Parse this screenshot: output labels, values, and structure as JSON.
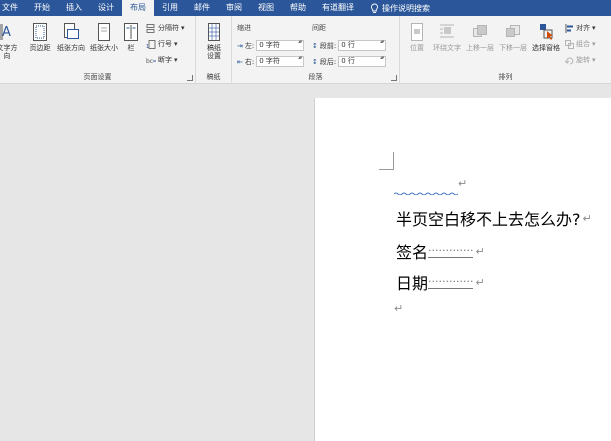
{
  "tabs": [
    {
      "label": "文件",
      "active": false
    },
    {
      "label": "开始",
      "active": false
    },
    {
      "label": "插入",
      "active": false
    },
    {
      "label": "设计",
      "active": false
    },
    {
      "label": "布局",
      "active": true
    },
    {
      "label": "引用",
      "active": false
    },
    {
      "label": "邮件",
      "active": false
    },
    {
      "label": "审阅",
      "active": false
    },
    {
      "label": "视图",
      "active": false
    },
    {
      "label": "帮助",
      "active": false
    },
    {
      "label": "有道翻译",
      "active": false
    }
  ],
  "tell_me": "操作说明搜索",
  "ribbon": {
    "page_setup": {
      "label": "页面设置",
      "text_direction": "文字方向",
      "margins": "页边距",
      "orientation": "纸张方向",
      "size": "纸张大小",
      "columns": "栏",
      "breaks": "分隔符",
      "line_numbers": "行号",
      "hyphenation": "断字"
    },
    "manuscript": {
      "label": "稿纸",
      "button": "稿纸设置"
    },
    "paragraph": {
      "label": "段落",
      "indent_heading": "缩进",
      "spacing_heading": "间距",
      "left_label": "左:",
      "left_value": "0 字符",
      "right_label": "右:",
      "right_value": "0 字符",
      "before_label": "段前:",
      "before_value": "0 行",
      "after_label": "段后:",
      "after_value": "0 行"
    },
    "arrange": {
      "label": "排列",
      "position": "位置",
      "wrap_text": "环绕文字",
      "bring_forward": "上移一层",
      "send_backward": "下移一层",
      "selection_pane": "选择窗格",
      "align": "对齐",
      "group": "组合",
      "rotate": "旋转"
    }
  },
  "document": {
    "line1": "半页空白移不上去怎么办?",
    "line2_label": "签名",
    "line3_label": "日期",
    "leader": "·············"
  },
  "colors": {
    "accent": "#2b579a"
  }
}
